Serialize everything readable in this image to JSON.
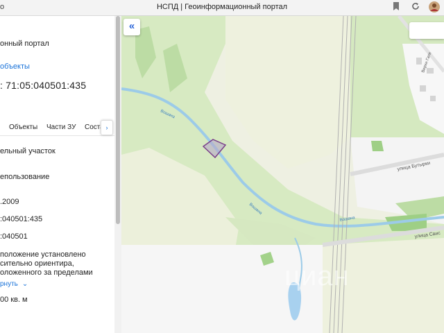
{
  "browser": {
    "left_text": "o",
    "title": "НСПД | Геоинформационный портал",
    "bookmark_icon": "bookmark-icon",
    "refresh_icon": "reload-icon"
  },
  "panel": {
    "title": "онный портал",
    "objects_link": "объекты",
    "cadastral_number": ": 71:05:040501:435",
    "tabs": [
      "Объекты",
      "Части ЗУ",
      "Соста"
    ],
    "tab_arrow": "›",
    "fields": {
      "type": "ельный участок",
      "use": "епользование",
      "date": ".2009",
      "number": ":040501:435",
      "quarter": ":040501",
      "location_lines": [
        "положение установлено",
        "сительно ориентира,",
        "оложенного за пределами"
      ],
      "area": "00 кв. м"
    },
    "collapse_label": "рнуть"
  },
  "map": {
    "back_button": "«",
    "streets": [
      "улица Бутырки",
      "улица Свис",
      "Верхн Гати"
    ],
    "rivers": [
      "Вошана",
      "Вошана",
      "Вошана"
    ],
    "watermark": "циан"
  }
}
